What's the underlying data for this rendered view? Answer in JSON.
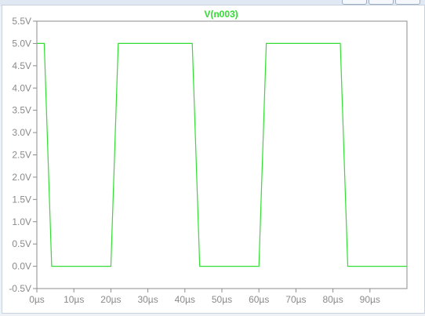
{
  "colors": {
    "trace": "#33dd33",
    "axis": "#8c8c8c",
    "text": "#8a8a8a",
    "background": "#ffffff"
  },
  "window_buttons": [
    "minimize-button",
    "maximize-button",
    "close-button"
  ],
  "chart_data": {
    "type": "line",
    "title": "V(n003)",
    "xlabel": "",
    "ylabel": "",
    "xlim": [
      0,
      100
    ],
    "ylim": [
      -0.5,
      5.5
    ],
    "x_unit": "µs",
    "y_unit": "V",
    "x_ticks": [
      "0µs",
      "10µs",
      "20µs",
      "30µs",
      "40µs",
      "50µs",
      "60µs",
      "70µs",
      "80µs",
      "90µs"
    ],
    "x_tick_values": [
      0,
      10,
      20,
      30,
      40,
      50,
      60,
      70,
      80,
      90
    ],
    "y_ticks": [
      "-0.5V",
      "0.0V",
      "0.5V",
      "1.0V",
      "1.5V",
      "2.0V",
      "2.5V",
      "3.0V",
      "3.5V",
      "4.0V",
      "4.5V",
      "5.0V",
      "5.5V"
    ],
    "y_tick_values": [
      -0.5,
      0,
      0.5,
      1,
      1.5,
      2,
      2.5,
      3,
      3.5,
      4,
      4.5,
      5,
      5.5
    ],
    "grid": false,
    "series": [
      {
        "name": "V(n003)",
        "x": [
          0,
          2,
          4,
          20,
          22,
          42,
          44,
          60,
          62,
          82,
          84,
          100
        ],
        "y": [
          5.0,
          5.0,
          0.0,
          0.0,
          5.0,
          5.0,
          0.0,
          0.0,
          5.0,
          5.0,
          0.0,
          0.0
        ]
      }
    ]
  }
}
